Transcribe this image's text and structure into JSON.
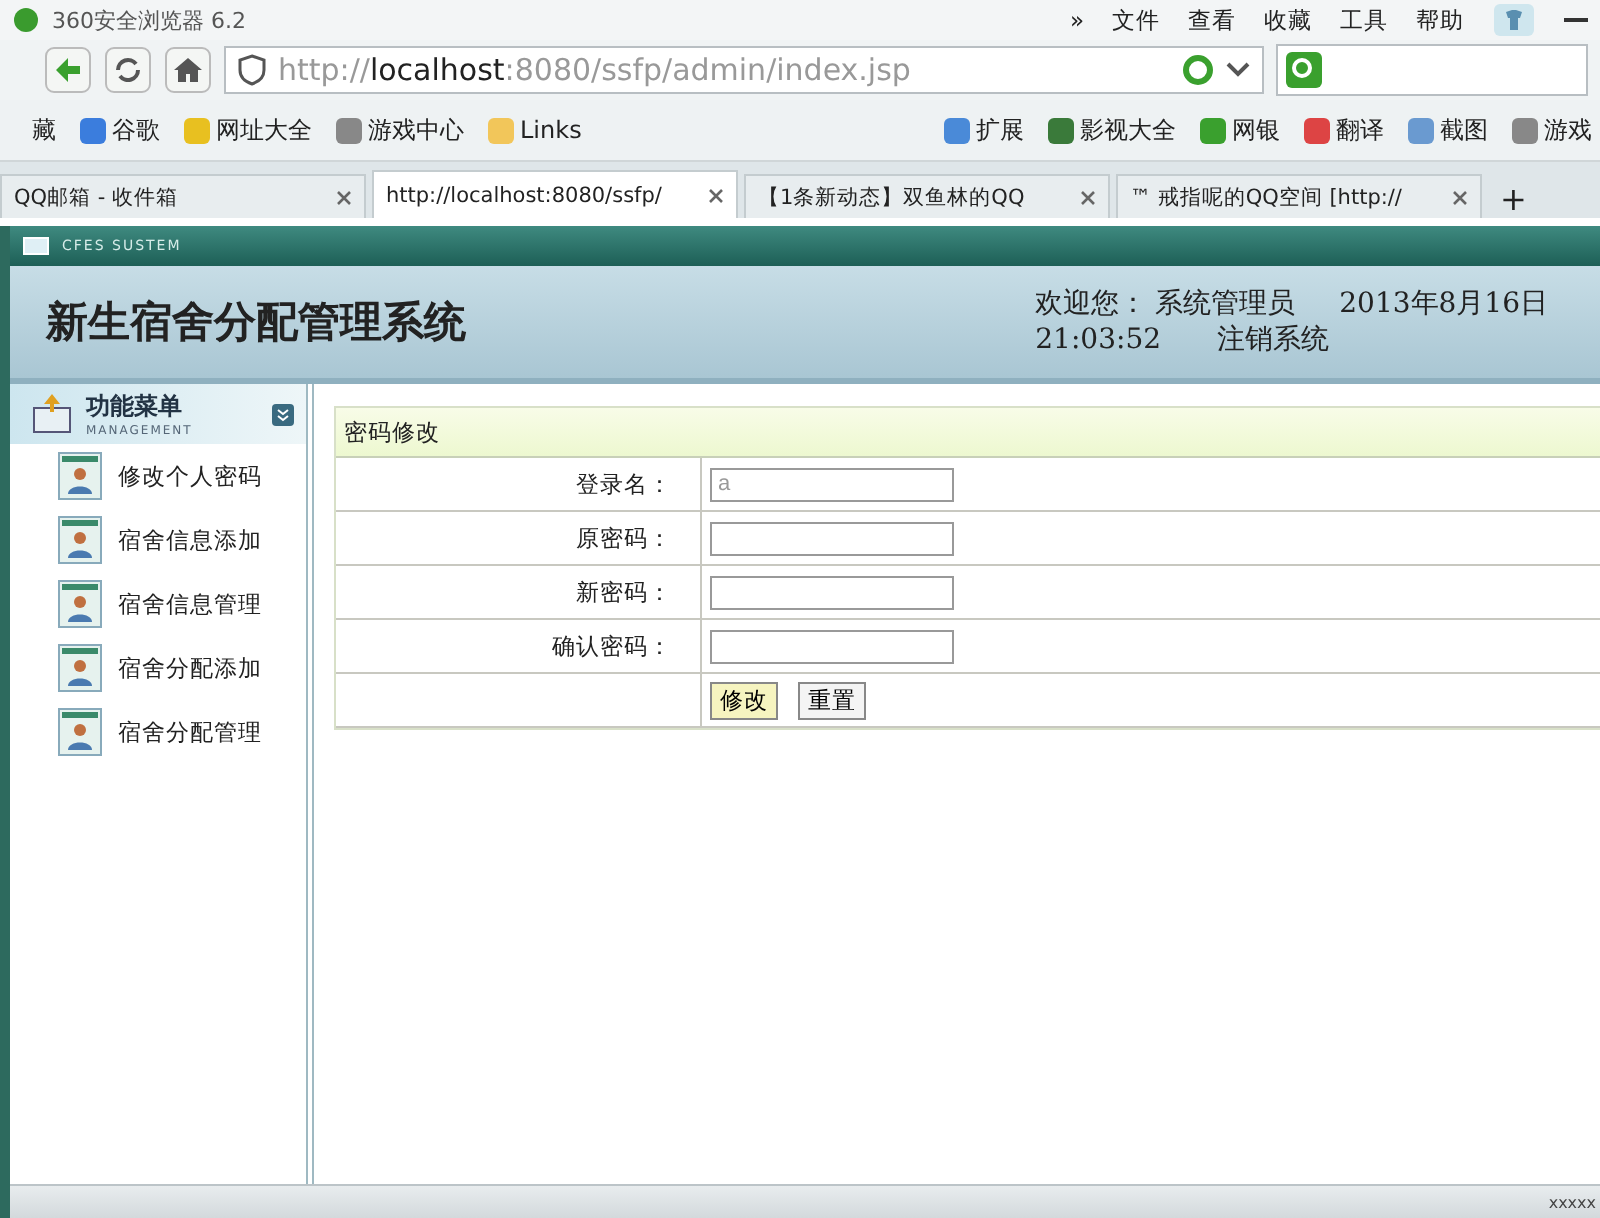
{
  "browser": {
    "title": "360安全浏览器 6.2",
    "menu": [
      "»",
      "文件",
      "查看",
      "收藏",
      "工具",
      "帮助"
    ],
    "address": {
      "scheme": "http://",
      "host": "localhost",
      "rest": ":8080/ssfp/admin/index.jsp"
    },
    "bookmarks_left": [
      "藏",
      "谷歌",
      "网址大全",
      "游戏中心",
      "Links"
    ],
    "bookmarks_right": [
      "扩展",
      "影视大全",
      "网银",
      "翻译",
      "截图",
      "游戏"
    ],
    "tabs": [
      {
        "label": "QQ邮箱 - 收件箱",
        "selected": false
      },
      {
        "label": "http://localhost:8080/ssfp/",
        "selected": true
      },
      {
        "label": "【1条新动态】双鱼林的QQ",
        "selected": false
      },
      {
        "label": "™ 戒指呢的QQ空间 [http://",
        "selected": false
      }
    ],
    "new_tab": "+"
  },
  "app": {
    "system_label": "CFES SUSTEM",
    "title": "新生宿舍分配管理系统",
    "welcome": "欢迎您：",
    "user": "系统管理员",
    "date": "2013年8月16日",
    "time": "21:03:52",
    "logout": "注销系统"
  },
  "sidebar": {
    "title": "功能菜单",
    "subtitle": "MANAGEMENT",
    "items": [
      "修改个人密码",
      "宿舍信息添加",
      "宿舍信息管理",
      "宿舍分配添加",
      "宿舍分配管理"
    ]
  },
  "form": {
    "title": "密码修改",
    "fields": [
      {
        "label": "登录名：",
        "value": "a"
      },
      {
        "label": "原密码："
      },
      {
        "label": "新密码："
      },
      {
        "label": "确认密码："
      }
    ],
    "buttons": [
      {
        "label": "修改",
        "selected": true
      },
      {
        "label": "重置",
        "selected": false
      }
    ]
  },
  "status_bar": {
    "text": "xxxxx"
  }
}
